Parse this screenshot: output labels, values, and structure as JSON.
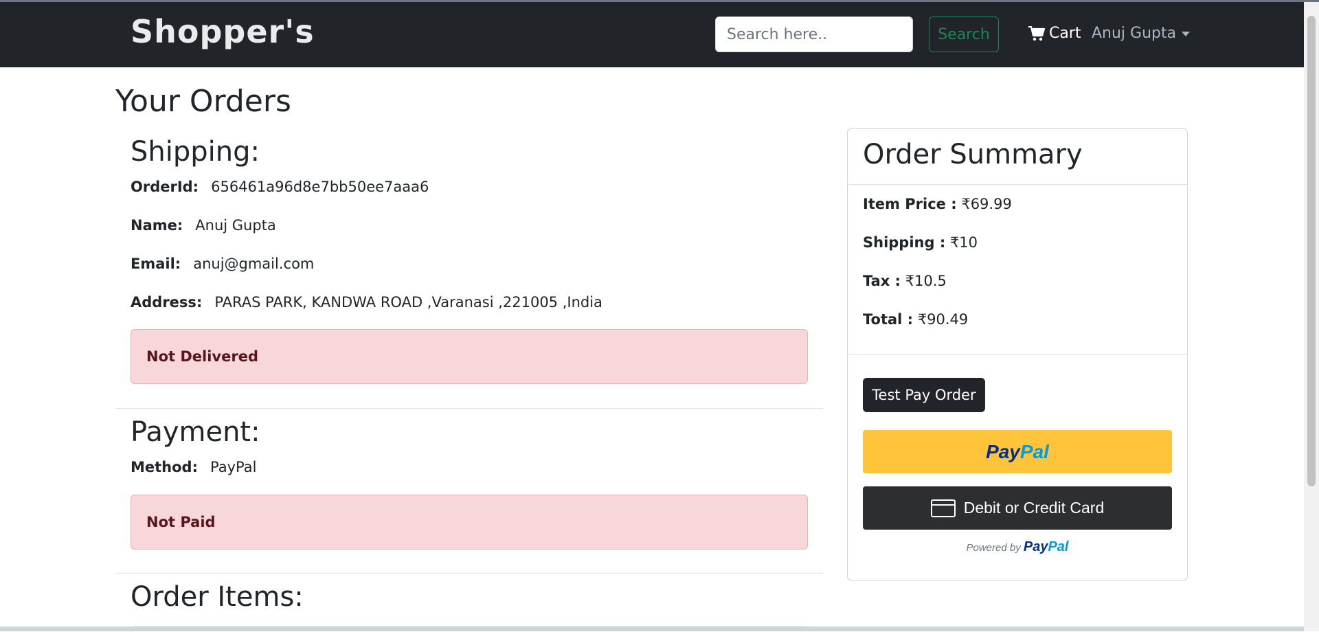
{
  "navbar": {
    "brand": "Shopper's",
    "search_placeholder": "Search here..",
    "search_button": "Search",
    "cart_label": "Cart",
    "user_name": "Anuj Gupta"
  },
  "page_title": "Your Orders",
  "shipping": {
    "heading": "Shipping:",
    "order_id_label": "OrderId:",
    "order_id": "656461a96d8e7bb50ee7aaa6",
    "name_label": "Name:",
    "name": "Anuj Gupta",
    "email_label": "Email:",
    "email": "anuj@gmail.com",
    "address_label": "Address:",
    "address": "PARAS PARK, KANDWA ROAD ,Varanasi ,221005 ,India",
    "status": "Not Delivered"
  },
  "payment": {
    "heading": "Payment:",
    "method_label": "Method:",
    "method": "PayPal",
    "status": "Not Paid"
  },
  "order_items": {
    "heading": "Order Items:"
  },
  "summary": {
    "title": "Order Summary",
    "item_price_label": "Item Price :",
    "item_price": "₹69.99",
    "shipping_label": "Shipping :",
    "shipping": "₹10",
    "tax_label": "Tax :",
    "tax": "₹10.5",
    "total_label": "Total :",
    "total": "₹90.49",
    "test_pay_button": "Test Pay Order",
    "paypal_part1": "Pay",
    "paypal_part2": "Pal",
    "card_button": "Debit or Credit Card",
    "powered_by": "Powered by",
    "powered_logo_part1": "Pay",
    "powered_logo_part2": "Pal"
  },
  "colors": {
    "navbar_bg": "#212529",
    "alert_bg": "#f8d7da",
    "alert_text": "#58151c",
    "search_button": "#198754",
    "paypal_yellow": "#ffc439",
    "paypal_dark_blue": "#003087",
    "paypal_light_blue": "#009cde"
  },
  "icons": {
    "cart": "shopping-cart-icon",
    "user_menu": "caret-down-icon",
    "card": "credit-card-icon"
  }
}
